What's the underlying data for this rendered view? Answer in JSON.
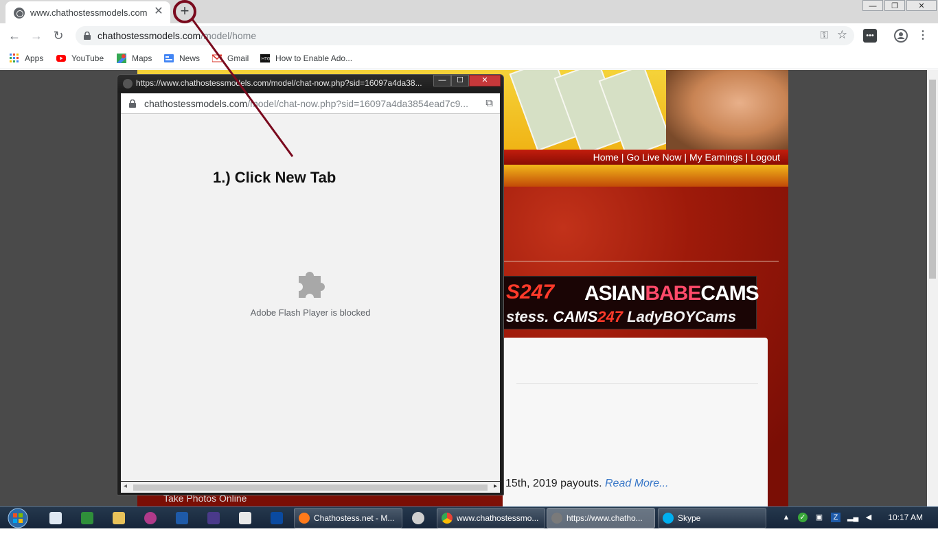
{
  "browser": {
    "tab_title": "www.chathostessmodels.com",
    "tab_close": "✕",
    "new_tab": "+",
    "url_domain": "chathostessmodels.com",
    "url_path": "/model/home",
    "window_controls": {
      "minimize": "—",
      "restore": "❐",
      "close": "✕"
    },
    "nav": {
      "back": "←",
      "forward": "→",
      "reload": "↻"
    }
  },
  "bookmarks": [
    {
      "label": "Apps",
      "icon": "apps-grid-icon"
    },
    {
      "label": "YouTube",
      "icon": "youtube-icon"
    },
    {
      "label": "Maps",
      "icon": "maps-icon"
    },
    {
      "label": "News",
      "icon": "news-icon"
    },
    {
      "label": "Gmail",
      "icon": "gmail-icon"
    },
    {
      "label": "How to Enable Ado...",
      "icon": "htg-icon"
    }
  ],
  "site": {
    "nav_links": "Home | Go Live Now | My Earnings | Logout",
    "logo_top_left": "S247",
    "logo_top_main": "ASIAN",
    "logo_top_pink": "BABE",
    "logo_top_end": "CAMS",
    "logo_bottom_left": "stess.",
    "logo_bottom_cams": "CAMS",
    "logo_bottom_num": "247",
    "logo_bottom_end": "LadyBOYCams",
    "payout_text": "15th, 2019 payouts. ",
    "read_more": "Read More...",
    "sidebar_text": "Take Photos Online"
  },
  "popup": {
    "title": "https://www.chathostessmodels.com/model/chat-now.php?sid=16097a4da38...",
    "url_domain": "chathostessmodels.com",
    "url_path": "/model/chat-now.php?sid=16097a4da3854ead7c9...",
    "flash_message": "Adobe Flash Player is blocked",
    "controls": {
      "minimize": "—",
      "maximize": "☐",
      "close": "✕"
    }
  },
  "annotation": {
    "instruction": "1.) Click New Tab",
    "color": "#7a0a1e"
  },
  "taskbar": {
    "tasks": [
      {
        "label": "Chathostess.net - M...",
        "icon": "firefox-icon"
      },
      {
        "label": "www.chathostessmo...",
        "icon": "chrome-icon"
      },
      {
        "label": "https://www.chatho...",
        "icon": "chrome-popup-icon"
      },
      {
        "label": "Skype",
        "icon": "skype-icon"
      }
    ],
    "clock": "10:17 AM"
  }
}
